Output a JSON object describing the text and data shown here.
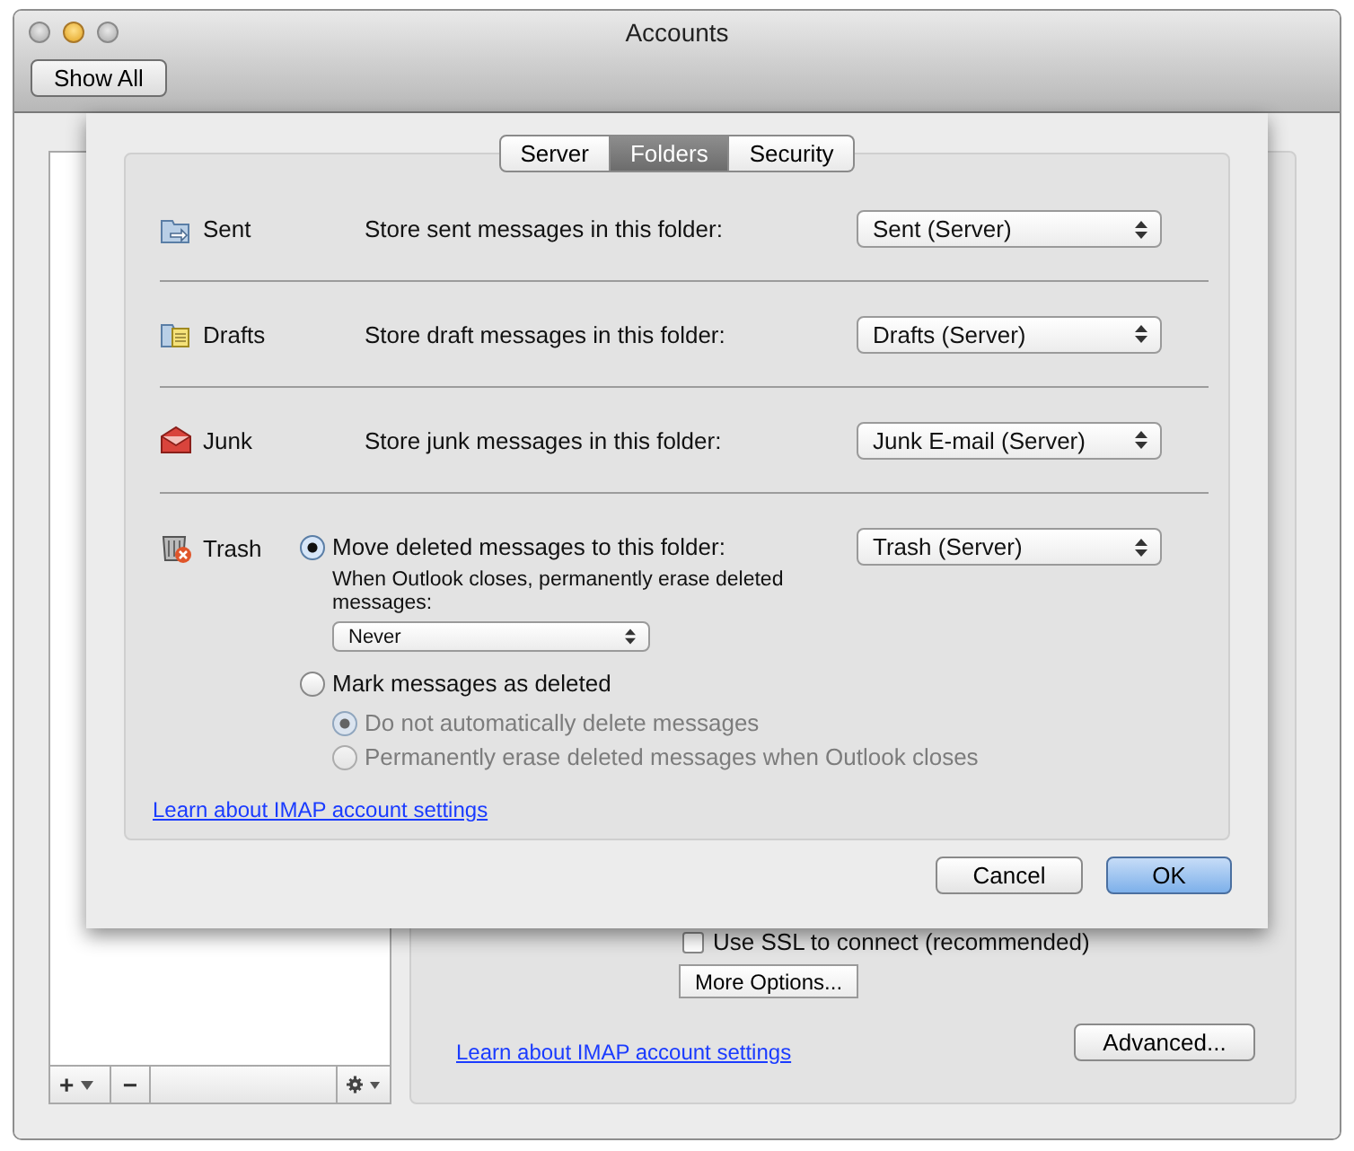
{
  "window": {
    "title": "Accounts"
  },
  "toolbar": {
    "show_all": "Show All"
  },
  "sidebar": {
    "add": "+",
    "remove": "−"
  },
  "account_panel": {
    "ssl": {
      "label": "Use SSL to connect (recommended)",
      "checked": false
    },
    "more_options": "More Options...",
    "learn_link": "Learn about IMAP account settings",
    "advanced": "Advanced..."
  },
  "sheet": {
    "tabs": [
      {
        "label": "Server",
        "selected": false
      },
      {
        "label": "Folders",
        "selected": true
      },
      {
        "label": "Security",
        "selected": false
      }
    ],
    "folders": [
      {
        "kind": "sent",
        "name": "Sent",
        "label": "Store sent messages in this folder:",
        "value": "Sent (Server)"
      },
      {
        "kind": "drafts",
        "name": "Drafts",
        "label": "Store draft messages in this folder:",
        "value": "Drafts (Server)"
      },
      {
        "kind": "junk",
        "name": "Junk",
        "label": "Store junk messages in this folder:",
        "value": "Junk E-mail (Server)"
      }
    ],
    "trash": {
      "name": "Trash",
      "move": {
        "label": "Move deleted messages to this folder:",
        "selected": true
      },
      "value": "Trash (Server)",
      "erase_note": "When Outlook closes, permanently erase deleted messages:",
      "erase_value": "Never",
      "mark": {
        "label": "Mark messages as deleted",
        "selected": false
      },
      "sub_options": [
        {
          "label": "Do not automatically delete messages",
          "selected": true,
          "disabled": true
        },
        {
          "label": "Permanently erase deleted messages when Outlook closes",
          "selected": false,
          "disabled": true
        }
      ]
    },
    "learn_link": "Learn about IMAP account settings",
    "buttons": [
      {
        "kind": "normal",
        "label": "Cancel"
      },
      {
        "kind": "default",
        "label": "OK"
      }
    ]
  }
}
